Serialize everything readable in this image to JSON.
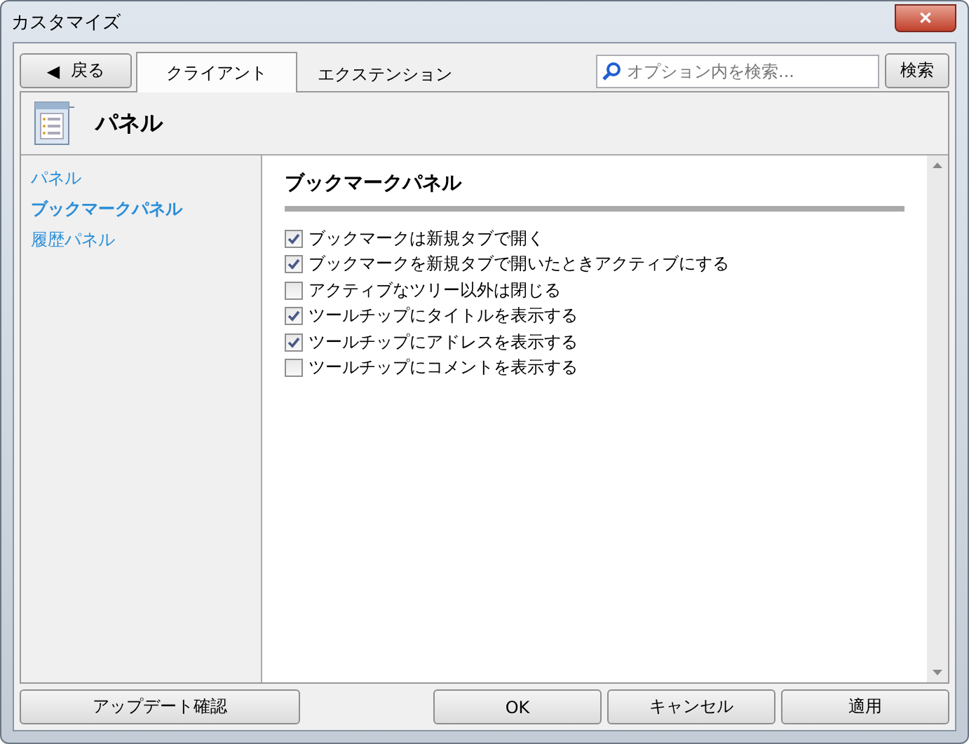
{
  "window": {
    "title": "カスタマイズ",
    "close": "✕"
  },
  "toolbar": {
    "back": {
      "icon": "◀",
      "label": "戻る"
    },
    "tabs": [
      {
        "label": "クライアント",
        "selected": true
      },
      {
        "label": "エクステンション",
        "selected": false
      }
    ],
    "search": {
      "placeholder": "オプション内を検索..."
    },
    "search_button": "検索"
  },
  "header": {
    "title": "パネル"
  },
  "sidebar": {
    "items": [
      {
        "label": "パネル",
        "selected": false
      },
      {
        "label": "ブックマークパネル",
        "selected": true
      },
      {
        "label": "履歴パネル",
        "selected": false
      }
    ]
  },
  "section": {
    "title": "ブックマークパネル",
    "options": [
      {
        "label": "ブックマークは新規タブで開く",
        "checked": true
      },
      {
        "label": "ブックマークを新規タブで開いたときアクティブにする",
        "checked": true
      },
      {
        "label": "アクティブなツリー以外は閉じる",
        "checked": false
      },
      {
        "label": "ツールチップにタイトルを表示する",
        "checked": true
      },
      {
        "label": "ツールチップにアドレスを表示する",
        "checked": true
      },
      {
        "label": "ツールチップにコメントを表示する",
        "checked": false
      }
    ]
  },
  "footer": {
    "left": "アップデート確認",
    "buttons": [
      "OK",
      "キャンセル",
      "適用"
    ]
  }
}
